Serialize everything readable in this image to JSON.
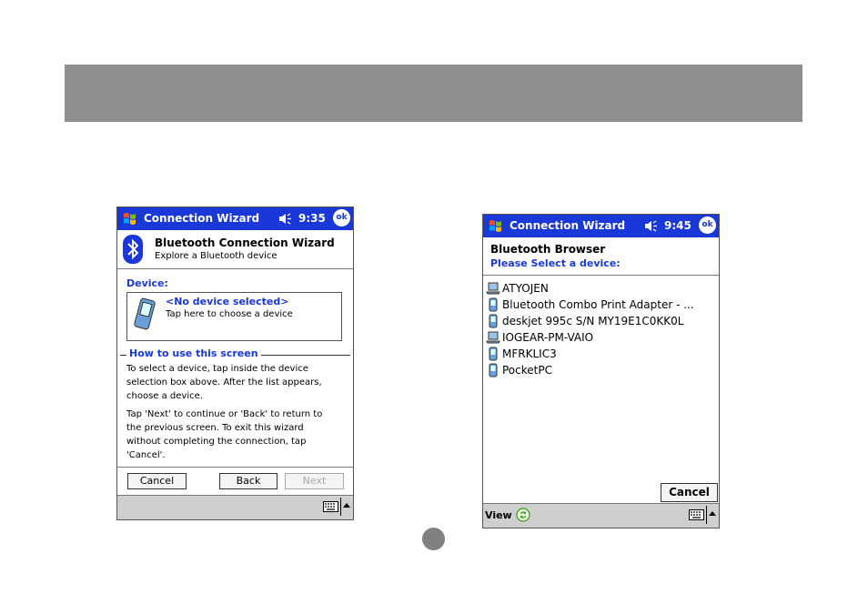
{
  "left_screen": {
    "titlebar": {
      "title": "Connection Wizard",
      "time": "9:35",
      "ok_label": "ok"
    },
    "header": {
      "title": "Bluetooth Connection Wizard",
      "subtitle": "Explore a Bluetooth device"
    },
    "device_label": "Device:",
    "selection": {
      "primary": "<No device selected>",
      "secondary": "Tap here to choose a device"
    },
    "howto_heading": "How to use this screen",
    "para1_lines": [
      "To select a device, tap inside the device",
      "selection box above. After the list appears,",
      "choose a device."
    ],
    "para2_lines": [
      "Tap 'Next' to continue or 'Back' to return to",
      "the previous screen. To exit this wizard",
      "without completing the connection, tap",
      "'Cancel'."
    ],
    "buttons": {
      "cancel": "Cancel",
      "back": "Back",
      "next": "Next"
    }
  },
  "right_screen": {
    "titlebar": {
      "title": "Connection Wizard",
      "time": "9:45",
      "ok_label": "ok"
    },
    "header": {
      "title": "Bluetooth Browser",
      "subtitle": "Please Select a device:"
    },
    "devices": [
      {
        "name": "ATYOJEN",
        "icon": "laptop-icon"
      },
      {
        "name": "Bluetooth Combo Print Adapter - ...",
        "icon": "pda-icon"
      },
      {
        "name": "deskjet 995c S/N MY19E1C0KK0L",
        "icon": "pda-icon"
      },
      {
        "name": "IOGEAR-PM-VAIO",
        "icon": "laptop-icon"
      },
      {
        "name": "MFRKLIC3",
        "icon": "pda-icon"
      },
      {
        "name": "PocketPC",
        "icon": "pda-icon"
      }
    ],
    "cancel_label": "Cancel",
    "menu": {
      "view_label": "View"
    }
  },
  "colors": {
    "titlebar": "#1a38d8",
    "banner": "#8f8f8f",
    "menubar": "#cfcfcf",
    "accent_text": "#1a38d8"
  }
}
